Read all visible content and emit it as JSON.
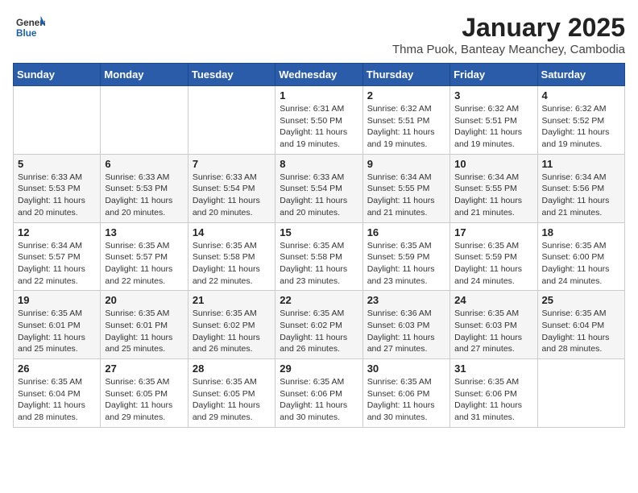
{
  "logo": {
    "line1": "General",
    "line2": "Blue"
  },
  "title": "January 2025",
  "subtitle": "Thma Puok, Banteay Meanchey, Cambodia",
  "days_header": [
    "Sunday",
    "Monday",
    "Tuesday",
    "Wednesday",
    "Thursday",
    "Friday",
    "Saturday"
  ],
  "weeks": [
    [
      {
        "day": "",
        "sunrise": "",
        "sunset": "",
        "daylight": ""
      },
      {
        "day": "",
        "sunrise": "",
        "sunset": "",
        "daylight": ""
      },
      {
        "day": "",
        "sunrise": "",
        "sunset": "",
        "daylight": ""
      },
      {
        "day": "1",
        "sunrise": "Sunrise: 6:31 AM",
        "sunset": "Sunset: 5:50 PM",
        "daylight": "Daylight: 11 hours and 19 minutes."
      },
      {
        "day": "2",
        "sunrise": "Sunrise: 6:32 AM",
        "sunset": "Sunset: 5:51 PM",
        "daylight": "Daylight: 11 hours and 19 minutes."
      },
      {
        "day": "3",
        "sunrise": "Sunrise: 6:32 AM",
        "sunset": "Sunset: 5:51 PM",
        "daylight": "Daylight: 11 hours and 19 minutes."
      },
      {
        "day": "4",
        "sunrise": "Sunrise: 6:32 AM",
        "sunset": "Sunset: 5:52 PM",
        "daylight": "Daylight: 11 hours and 19 minutes."
      }
    ],
    [
      {
        "day": "5",
        "sunrise": "Sunrise: 6:33 AM",
        "sunset": "Sunset: 5:53 PM",
        "daylight": "Daylight: 11 hours and 20 minutes."
      },
      {
        "day": "6",
        "sunrise": "Sunrise: 6:33 AM",
        "sunset": "Sunset: 5:53 PM",
        "daylight": "Daylight: 11 hours and 20 minutes."
      },
      {
        "day": "7",
        "sunrise": "Sunrise: 6:33 AM",
        "sunset": "Sunset: 5:54 PM",
        "daylight": "Daylight: 11 hours and 20 minutes."
      },
      {
        "day": "8",
        "sunrise": "Sunrise: 6:33 AM",
        "sunset": "Sunset: 5:54 PM",
        "daylight": "Daylight: 11 hours and 20 minutes."
      },
      {
        "day": "9",
        "sunrise": "Sunrise: 6:34 AM",
        "sunset": "Sunset: 5:55 PM",
        "daylight": "Daylight: 11 hours and 21 minutes."
      },
      {
        "day": "10",
        "sunrise": "Sunrise: 6:34 AM",
        "sunset": "Sunset: 5:55 PM",
        "daylight": "Daylight: 11 hours and 21 minutes."
      },
      {
        "day": "11",
        "sunrise": "Sunrise: 6:34 AM",
        "sunset": "Sunset: 5:56 PM",
        "daylight": "Daylight: 11 hours and 21 minutes."
      }
    ],
    [
      {
        "day": "12",
        "sunrise": "Sunrise: 6:34 AM",
        "sunset": "Sunset: 5:57 PM",
        "daylight": "Daylight: 11 hours and 22 minutes."
      },
      {
        "day": "13",
        "sunrise": "Sunrise: 6:35 AM",
        "sunset": "Sunset: 5:57 PM",
        "daylight": "Daylight: 11 hours and 22 minutes."
      },
      {
        "day": "14",
        "sunrise": "Sunrise: 6:35 AM",
        "sunset": "Sunset: 5:58 PM",
        "daylight": "Daylight: 11 hours and 22 minutes."
      },
      {
        "day": "15",
        "sunrise": "Sunrise: 6:35 AM",
        "sunset": "Sunset: 5:58 PM",
        "daylight": "Daylight: 11 hours and 23 minutes."
      },
      {
        "day": "16",
        "sunrise": "Sunrise: 6:35 AM",
        "sunset": "Sunset: 5:59 PM",
        "daylight": "Daylight: 11 hours and 23 minutes."
      },
      {
        "day": "17",
        "sunrise": "Sunrise: 6:35 AM",
        "sunset": "Sunset: 5:59 PM",
        "daylight": "Daylight: 11 hours and 24 minutes."
      },
      {
        "day": "18",
        "sunrise": "Sunrise: 6:35 AM",
        "sunset": "Sunset: 6:00 PM",
        "daylight": "Daylight: 11 hours and 24 minutes."
      }
    ],
    [
      {
        "day": "19",
        "sunrise": "Sunrise: 6:35 AM",
        "sunset": "Sunset: 6:01 PM",
        "daylight": "Daylight: 11 hours and 25 minutes."
      },
      {
        "day": "20",
        "sunrise": "Sunrise: 6:35 AM",
        "sunset": "Sunset: 6:01 PM",
        "daylight": "Daylight: 11 hours and 25 minutes."
      },
      {
        "day": "21",
        "sunrise": "Sunrise: 6:35 AM",
        "sunset": "Sunset: 6:02 PM",
        "daylight": "Daylight: 11 hours and 26 minutes."
      },
      {
        "day": "22",
        "sunrise": "Sunrise: 6:35 AM",
        "sunset": "Sunset: 6:02 PM",
        "daylight": "Daylight: 11 hours and 26 minutes."
      },
      {
        "day": "23",
        "sunrise": "Sunrise: 6:36 AM",
        "sunset": "Sunset: 6:03 PM",
        "daylight": "Daylight: 11 hours and 27 minutes."
      },
      {
        "day": "24",
        "sunrise": "Sunrise: 6:35 AM",
        "sunset": "Sunset: 6:03 PM",
        "daylight": "Daylight: 11 hours and 27 minutes."
      },
      {
        "day": "25",
        "sunrise": "Sunrise: 6:35 AM",
        "sunset": "Sunset: 6:04 PM",
        "daylight": "Daylight: 11 hours and 28 minutes."
      }
    ],
    [
      {
        "day": "26",
        "sunrise": "Sunrise: 6:35 AM",
        "sunset": "Sunset: 6:04 PM",
        "daylight": "Daylight: 11 hours and 28 minutes."
      },
      {
        "day": "27",
        "sunrise": "Sunrise: 6:35 AM",
        "sunset": "Sunset: 6:05 PM",
        "daylight": "Daylight: 11 hours and 29 minutes."
      },
      {
        "day": "28",
        "sunrise": "Sunrise: 6:35 AM",
        "sunset": "Sunset: 6:05 PM",
        "daylight": "Daylight: 11 hours and 29 minutes."
      },
      {
        "day": "29",
        "sunrise": "Sunrise: 6:35 AM",
        "sunset": "Sunset: 6:06 PM",
        "daylight": "Daylight: 11 hours and 30 minutes."
      },
      {
        "day": "30",
        "sunrise": "Sunrise: 6:35 AM",
        "sunset": "Sunset: 6:06 PM",
        "daylight": "Daylight: 11 hours and 30 minutes."
      },
      {
        "day": "31",
        "sunrise": "Sunrise: 6:35 AM",
        "sunset": "Sunset: 6:06 PM",
        "daylight": "Daylight: 11 hours and 31 minutes."
      },
      {
        "day": "",
        "sunrise": "",
        "sunset": "",
        "daylight": ""
      }
    ]
  ]
}
